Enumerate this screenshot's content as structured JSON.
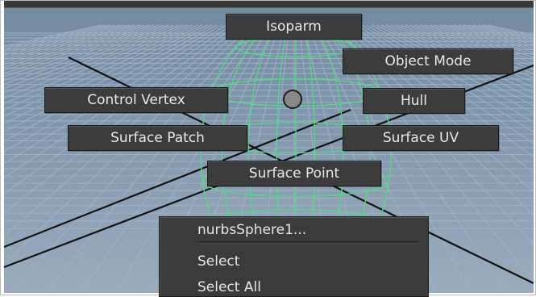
{
  "marking_menu": {
    "isoparm": "Isoparm",
    "object_mode": "Object Mode",
    "control_vertex": "Control Vertex",
    "hull": "Hull",
    "surface_patch": "Surface Patch",
    "surface_uv": "Surface UV",
    "surface_point": "Surface Point"
  },
  "context_menu": {
    "object_name": "nurbsSphere1...",
    "select": "Select",
    "select_all": "Select All"
  },
  "colors": {
    "viewport_bg": "#8096ac",
    "grid_line": "#9eb0c2",
    "wireframe": "#58d488",
    "menu_bg": "#3c3c3c",
    "menu_text": "#e8e8e8"
  }
}
